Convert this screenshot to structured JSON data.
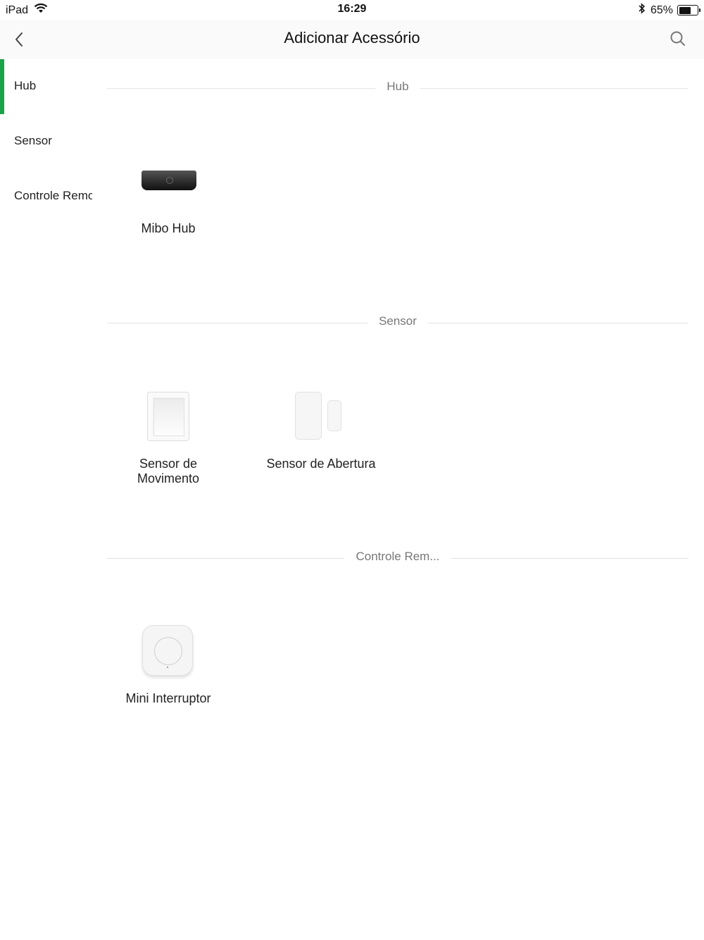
{
  "status_bar": {
    "device": "iPad",
    "time": "16:29",
    "battery_percent": "65%",
    "battery_level": 0.65,
    "icons": [
      "wifi-icon",
      "bluetooth-icon",
      "battery-icon"
    ]
  },
  "nav": {
    "title": "Adicionar Acessório",
    "back_icon": "chevron-left-icon",
    "search_icon": "search-icon"
  },
  "sidebar": {
    "accent_color": "#1ba34a",
    "items": [
      {
        "label": "Hub",
        "active": true
      },
      {
        "label": "Sensor",
        "active": false
      },
      {
        "label": "Controle Remoto",
        "active": false
      }
    ]
  },
  "sections": [
    {
      "title": "Hub",
      "devices": [
        {
          "name": "Mibo Hub",
          "icon": "hub-icon"
        }
      ]
    },
    {
      "title": "Sensor",
      "devices": [
        {
          "name_line1": "Sensor de",
          "name_line2": "Movimento",
          "icon": "motion-sensor-icon"
        },
        {
          "name": "Sensor de Abertura",
          "icon": "door-sensor-icon"
        }
      ]
    },
    {
      "title": "Controle Rem...",
      "devices": [
        {
          "name": "Mini Interruptor",
          "icon": "wireless-switch-icon"
        }
      ]
    }
  ]
}
